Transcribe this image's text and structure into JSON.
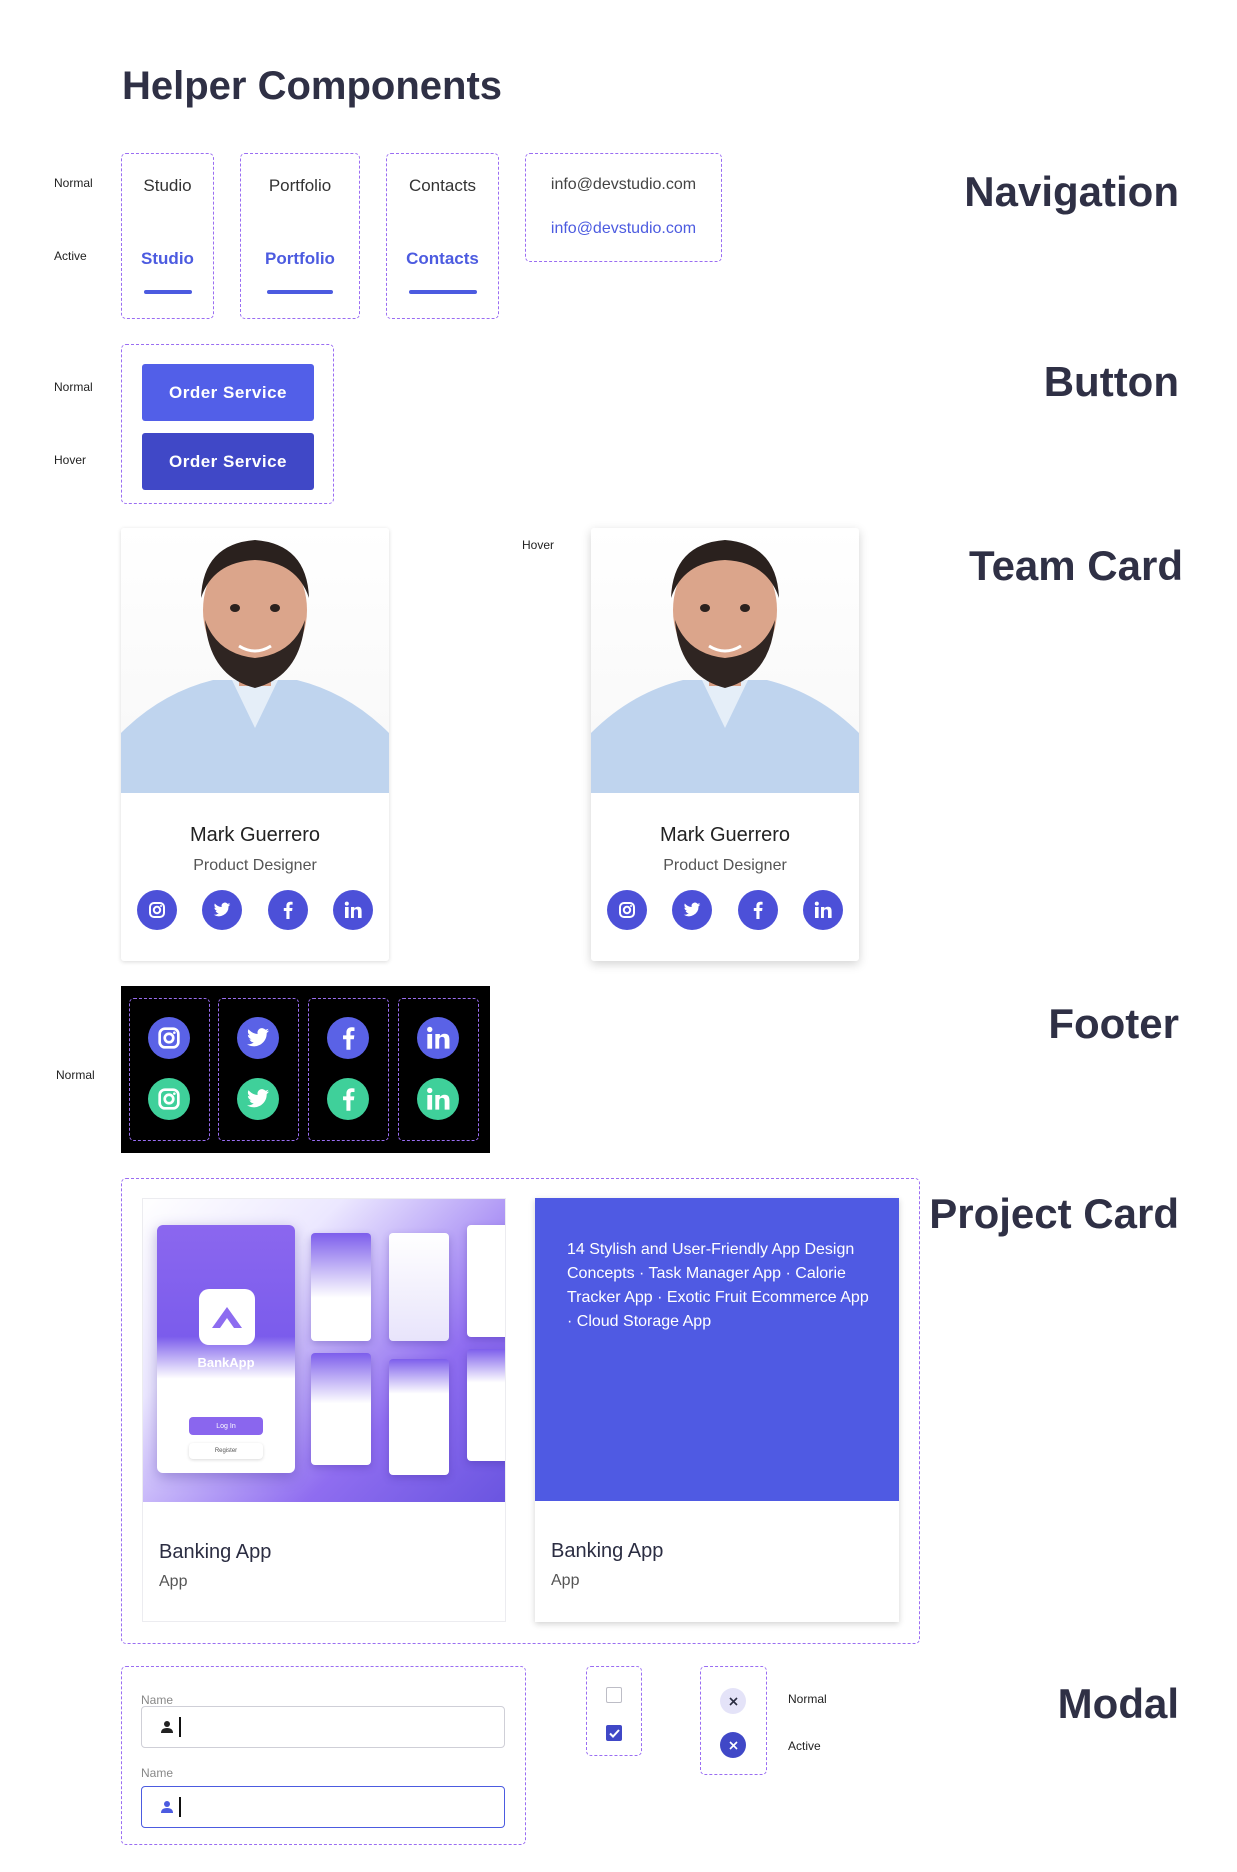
{
  "page_title": "Helper Components",
  "sections": {
    "navigation": "Navigation",
    "button": "Button",
    "team_card": "Team Card",
    "footer": "Footer",
    "project_card": "Project Card",
    "modal": "Modal"
  },
  "states": {
    "normal": "Normal",
    "active": "Active",
    "hover": "Hover"
  },
  "nav": {
    "items": [
      "Studio",
      "Portfolio",
      "Contacts"
    ],
    "email": "info@devstudio.com"
  },
  "button": {
    "label": "Order Service"
  },
  "team": {
    "name": "Mark Guerrero",
    "role": "Product Designer"
  },
  "project": {
    "title": "Banking App",
    "subtitle": "App",
    "mock_brand": "BankApp",
    "mock_login": "Log In",
    "mock_register": "Register",
    "description": "14 Stylish and User-Friendly App Design Concepts · Task Manager App · Calorie Tracker App · Exotic Fruit Ecommerce App · Cloud Storage App"
  },
  "modal": {
    "field_label": "Name"
  },
  "colors": {
    "accent": "#525fe8",
    "accent_dark": "#4048c7",
    "social_green": "#3fd09a",
    "dash": "#9a6df2"
  }
}
